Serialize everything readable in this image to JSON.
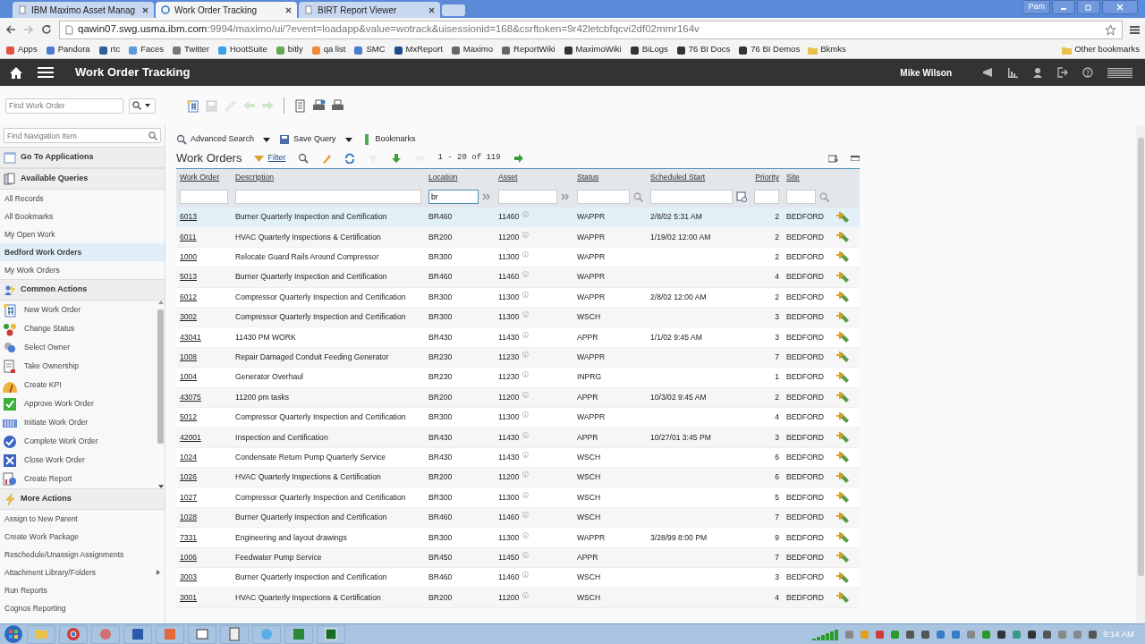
{
  "browser": {
    "tabs": [
      {
        "title": "IBM Maximo Asset Manag",
        "selected": false
      },
      {
        "title": "Work Order Tracking",
        "selected": true
      },
      {
        "title": "BIRT Report Viewer",
        "selected": false
      }
    ],
    "profile": "Pam",
    "address": {
      "host": "qawin07.swg.usma.ibm.com",
      "rest": ":9994/maximo/ui/?event=loadapp&value=wotrack&uisessionid=168&csrftoken=9r42letcbfqcvi2df02mmr164v"
    },
    "bookmarks": [
      "Apps",
      "Pandora",
      "rtc",
      "Faces",
      "Twitter",
      "HootSuite",
      "bitly",
      "qa list",
      "SMC",
      "MxReport",
      "Maximo",
      "ReportWiki",
      "MaximoWiki",
      "BiLogs",
      "76 BI Docs",
      "76 BI Demos",
      "Bkmks"
    ],
    "other_bookmarks": "Other bookmarks"
  },
  "app": {
    "title": "Work Order Tracking",
    "user": "Mike Wilson"
  },
  "toolbar": {
    "search_placeholder": "Find Work Order"
  },
  "sidebar": {
    "search_placeholder": "Find Navigation Item",
    "sections": [
      {
        "title": "Go To Applications",
        "kind": "plain"
      },
      {
        "title": "Available Queries",
        "kind": "plain",
        "items": [
          {
            "label": "All Records",
            "selected": false
          },
          {
            "label": "All Bookmarks",
            "selected": false
          },
          {
            "label": "My Open Work",
            "selected": false
          },
          {
            "label": "Bedford Work Orders",
            "selected": true
          },
          {
            "label": "My Work Orders",
            "selected": false
          }
        ]
      },
      {
        "title": "Common Actions",
        "kind": "icons",
        "items": [
          {
            "label": "New Work Order",
            "selected": false
          },
          {
            "label": "Change Status",
            "selected": false
          },
          {
            "label": "Select Owner",
            "selected": false
          },
          {
            "label": "Take Ownership",
            "selected": false
          },
          {
            "label": "Create KPI",
            "selected": false
          },
          {
            "label": "Approve Work Order",
            "selected": false
          },
          {
            "label": "Initiate Work Order",
            "selected": false
          },
          {
            "label": "Complete Work Order",
            "selected": false
          },
          {
            "label": "Close Work Order",
            "selected": false
          },
          {
            "label": "Create Report",
            "selected": false
          }
        ]
      },
      {
        "title": "More Actions",
        "kind": "plain",
        "items": [
          {
            "label": "Assign to New Parent",
            "selected": false
          },
          {
            "label": "Create Work Package",
            "selected": false
          },
          {
            "label": "Reschedule/Unassign Assignments",
            "selected": false
          },
          {
            "label": "Attachment Library/Folders",
            "selected": false,
            "submenu": true
          },
          {
            "label": "Run Reports",
            "selected": false
          },
          {
            "label": "Cognos Reporting",
            "selected": false
          }
        ]
      }
    ]
  },
  "query_bar": [
    "Advanced Search",
    "Save Query",
    "Bookmarks"
  ],
  "table": {
    "title": "Work Orders",
    "filter": "Filter",
    "pager": "1 -  20 of 119",
    "columns": [
      {
        "label": "Work Order"
      },
      {
        "label": "Description"
      },
      {
        "label": "Location",
        "filter_value": "br"
      },
      {
        "label": "Asset"
      },
      {
        "label": "Status"
      },
      {
        "label": "Scheduled Start"
      },
      {
        "label": "Priority"
      },
      {
        "label": "Site"
      }
    ],
    "rows": [
      {
        "work_order": "6013",
        "description": "Burner Quarterly Inspection and Certification",
        "location": "BR460",
        "asset": "11460",
        "status": "WAPPR",
        "scheduled_start": "2/8/02 5:31 AM",
        "priority": "2",
        "site": "BEDFORD",
        "selected": true
      },
      {
        "work_order": "6011",
        "description": "HVAC Quarterly Inspections & Certification",
        "location": "BR200",
        "asset": "11200",
        "status": "WAPPR",
        "scheduled_start": "1/19/02 12:00 AM",
        "priority": "2",
        "site": "BEDFORD",
        "selected": false
      },
      {
        "work_order": "1000",
        "description": "Relocate Guard Rails Around Compressor",
        "location": "BR300",
        "asset": "11300",
        "status": "WAPPR",
        "priority": "2",
        "site": "BEDFORD",
        "selected": false
      },
      {
        "work_order": "5013",
        "description": "Burner Quarterly Inspection and Certification",
        "location": "BR460",
        "asset": "11460",
        "status": "WAPPR",
        "priority": "4",
        "site": "BEDFORD",
        "selected": false
      },
      {
        "work_order": "6012",
        "description": "Compressor Quarterly Inspection and Certification",
        "location": "BR300",
        "asset": "11300",
        "status": "WAPPR",
        "scheduled_start": "2/8/02 12:00 AM",
        "priority": "2",
        "site": "BEDFORD",
        "selected": false
      },
      {
        "work_order": "3002",
        "description": "Compressor Quarterly Inspection and Certification",
        "location": "BR300",
        "asset": "11300",
        "status": "WSCH",
        "priority": "3",
        "site": "BEDFORD",
        "selected": false
      },
      {
        "work_order": "43041",
        "description": "11430 PM WORK",
        "location": "BR430",
        "asset": "11430",
        "status": "APPR",
        "scheduled_start": "1/1/02 9:45 AM",
        "priority": "3",
        "site": "BEDFORD",
        "selected": false
      },
      {
        "work_order": "1008",
        "description": "Repair Damaged Conduit Feeding Generator",
        "location": "BR230",
        "asset": "11230",
        "status": "WAPPR",
        "priority": "7",
        "site": "BEDFORD",
        "selected": false
      },
      {
        "work_order": "1004",
        "description": "Generator Overhaul",
        "location": "BR230",
        "asset": "11230",
        "status": "INPRG",
        "priority": "1",
        "site": "BEDFORD",
        "selected": false
      },
      {
        "work_order": "43075",
        "description": "11200 pm tasks",
        "location": "BR200",
        "asset": "11200",
        "status": "APPR",
        "scheduled_start": "10/3/02 9:45 AM",
        "priority": "2",
        "site": "BEDFORD",
        "selected": false
      },
      {
        "work_order": "5012",
        "description": "Compressor Quarterly Inspection and Certification",
        "location": "BR300",
        "asset": "11300",
        "status": "WAPPR",
        "priority": "4",
        "site": "BEDFORD",
        "selected": false
      },
      {
        "work_order": "42001",
        "description": "Inspection and Certification",
        "location": "BR430",
        "asset": "11430",
        "status": "APPR",
        "scheduled_start": "10/27/01 3:45 PM",
        "priority": "3",
        "site": "BEDFORD",
        "selected": false
      },
      {
        "work_order": "1024",
        "description": "Condensate Return Pump Quarterly Service",
        "location": "BR430",
        "asset": "11430",
        "status": "WSCH",
        "priority": "6",
        "site": "BEDFORD",
        "selected": false
      },
      {
        "work_order": "1026",
        "description": "HVAC Quarterly Inspections & Certification",
        "location": "BR200",
        "asset": "11200",
        "status": "WSCH",
        "priority": "6",
        "site": "BEDFORD",
        "selected": false
      },
      {
        "work_order": "1027",
        "description": "Compressor Quarterly Inspection and Certification",
        "location": "BR300",
        "asset": "11300",
        "status": "WSCH",
        "priority": "5",
        "site": "BEDFORD",
        "selected": false
      },
      {
        "work_order": "1028",
        "description": "Burner Quarterly Inspection and Certification",
        "location": "BR460",
        "asset": "11460",
        "status": "WSCH",
        "priority": "7",
        "site": "BEDFORD",
        "selected": false
      },
      {
        "work_order": "7331",
        "description": "Engineering and layout drawings",
        "location": "BR300",
        "asset": "11300",
        "status": "WAPPR",
        "scheduled_start": "3/28/99 8:00 PM",
        "priority": "9",
        "site": "BEDFORD",
        "selected": false
      },
      {
        "work_order": "1006",
        "description": "Feedwater Pump Service",
        "location": "BR450",
        "asset": "11450",
        "status": "APPR",
        "priority": "7",
        "site": "BEDFORD",
        "selected": false
      },
      {
        "work_order": "3003",
        "description": "Burner Quarterly Inspection and Certification",
        "location": "BR460",
        "asset": "11460",
        "status": "WSCH",
        "priority": "3",
        "site": "BEDFORD",
        "selected": false
      },
      {
        "work_order": "3001",
        "description": "HVAC Quarterly Inspections & Certification",
        "location": "BR200",
        "asset": "11200",
        "status": "WSCH",
        "priority": "4",
        "site": "BEDFORD",
        "selected": false
      }
    ]
  },
  "taskbar": {
    "time": "9:14 AM"
  }
}
